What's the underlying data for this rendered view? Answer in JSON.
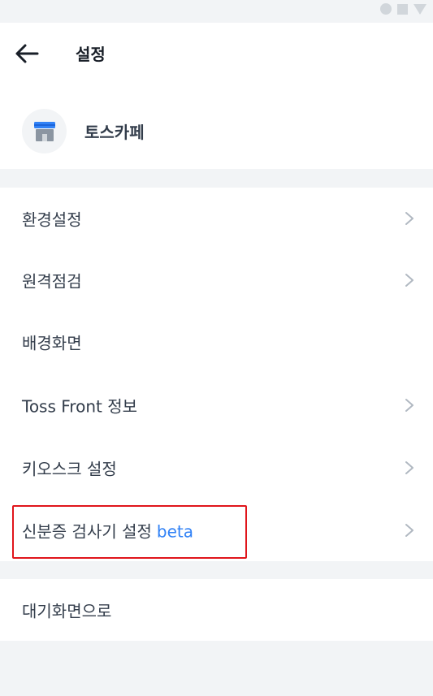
{
  "status_bar": {
    "icons": [
      "circle-icon",
      "square-icon",
      "triangle-icon"
    ]
  },
  "header": {
    "title": "설정",
    "back_icon": "arrow-left-icon"
  },
  "store": {
    "name": "토스카페",
    "icon": "store-icon"
  },
  "menu": {
    "items": [
      {
        "label": "환경설정",
        "has_chevron": true
      },
      {
        "label": "원격점검",
        "has_chevron": true
      },
      {
        "label": "배경화면",
        "has_chevron": false
      },
      {
        "label": "Toss Front 정보",
        "has_chevron": true
      },
      {
        "label": "키오스크 설정",
        "has_chevron": true
      },
      {
        "label": "신분증 검사기 설정",
        "badge": "beta",
        "has_chevron": true
      }
    ]
  },
  "bottom": {
    "label": "대기화면으로"
  },
  "colors": {
    "background": "#f2f4f6",
    "text": "#333d4b",
    "accent": "#3182f6",
    "highlight": "#e0151b"
  }
}
